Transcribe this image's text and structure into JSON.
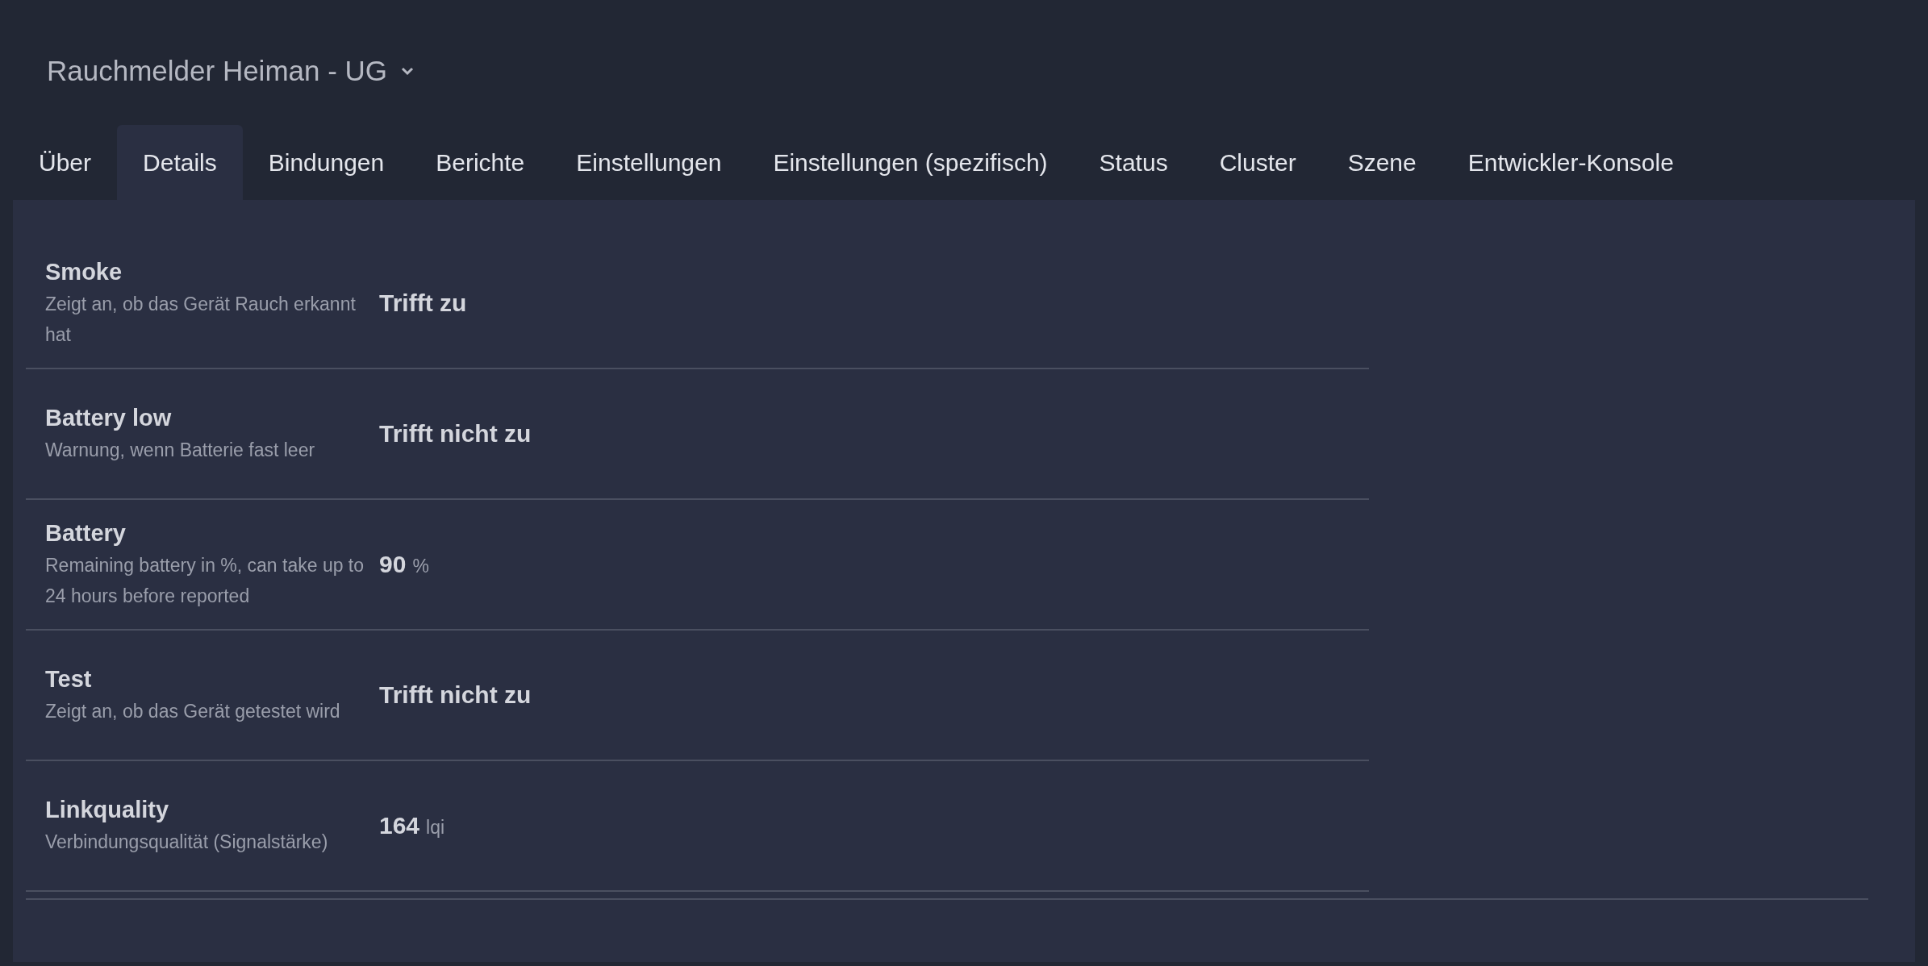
{
  "header": {
    "title": "Rauchmelder Heiman - UG"
  },
  "tabs": [
    {
      "label": "Über",
      "selected": false
    },
    {
      "label": "Details",
      "selected": true
    },
    {
      "label": "Bindungen",
      "selected": false
    },
    {
      "label": "Berichte",
      "selected": false
    },
    {
      "label": "Einstellungen",
      "selected": false
    },
    {
      "label": "Einstellungen (spezifisch)",
      "selected": false
    },
    {
      "label": "Status",
      "selected": false
    },
    {
      "label": "Cluster",
      "selected": false
    },
    {
      "label": "Szene",
      "selected": false
    },
    {
      "label": "Entwickler-Konsole",
      "selected": false
    }
  ],
  "rows": [
    {
      "name": "Smoke",
      "description": "Zeigt an, ob das Gerät Rauch erkannt hat",
      "value": "Trifft zu"
    },
    {
      "name": "Battery low",
      "description": "Warnung, wenn Batterie fast leer",
      "value": "Trifft nicht zu"
    },
    {
      "name": "Battery",
      "description": "Remaining battery in %, can take up to 24 hours before reported",
      "value": "90",
      "unit": "%"
    },
    {
      "name": "Test",
      "description": "Zeigt an, ob das Gerät getestet wird",
      "value": "Trifft nicht zu"
    },
    {
      "name": "Linkquality",
      "description": "Verbindungsqualität (Signalstärke)",
      "value": "164",
      "unit": "lqi"
    }
  ]
}
